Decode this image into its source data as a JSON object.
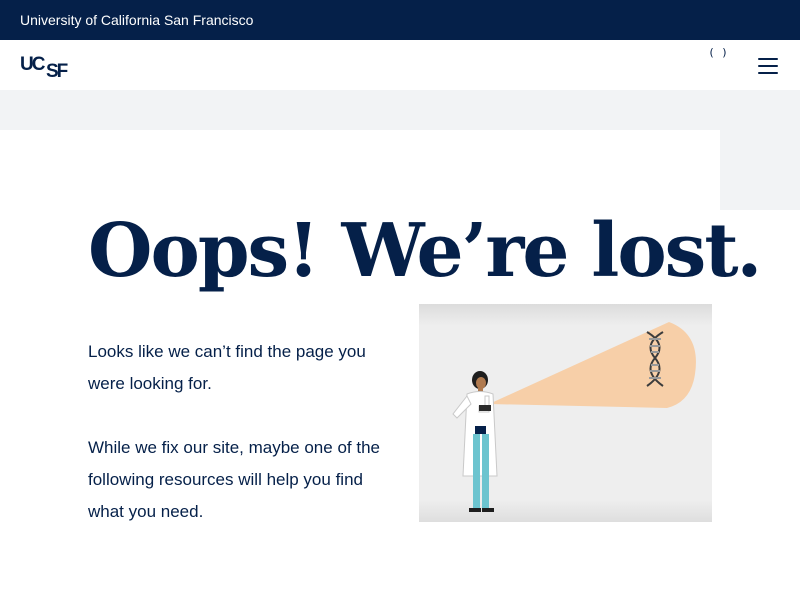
{
  "top_bar": {
    "institution": "University of California San Francisco"
  },
  "header": {
    "logo_text": "UCSF",
    "search_glyph": "( )",
    "menu_icon": "hamburger-icon"
  },
  "main": {
    "heading": "Oops! We’re lost.",
    "paragraphs": [
      "Looks like we can’t find the page you were looking for.",
      "While we fix our site, maybe one of the following resources will help you find what you need."
    ],
    "illustration": "scientist-flashlight-dna-illustration"
  },
  "colors": {
    "navy": "#052049",
    "band_gray": "#f2f3f5",
    "beam_peach": "#f7cfa8",
    "coat_white": "#ffffff",
    "pants_teal": "#6cc4cf"
  }
}
